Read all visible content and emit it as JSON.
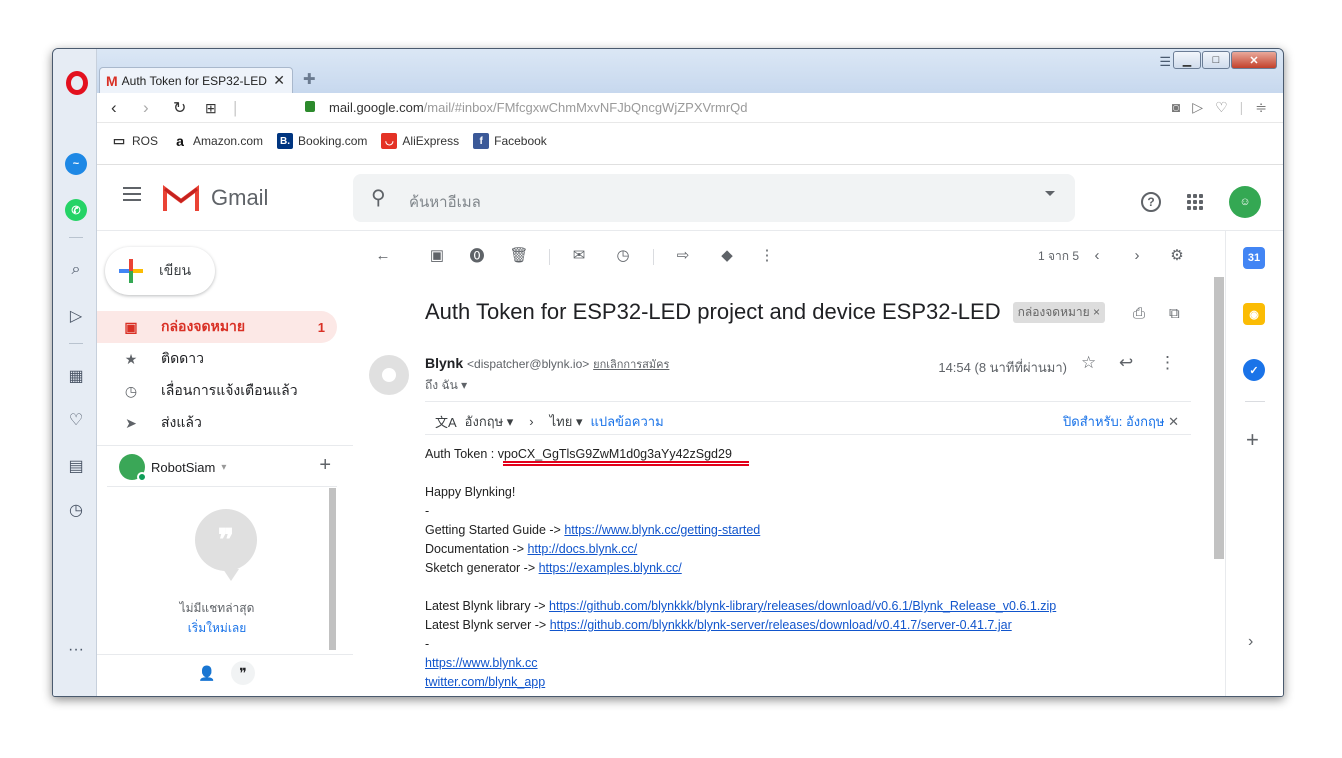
{
  "tab": {
    "title": "Auth Token for ESP32-LED",
    "favicon": "M"
  },
  "address": {
    "domain": "mail.google.com",
    "path": "/mail/#inbox/FMfcgxwChmMxvNFJbQncgWjZPXVrmrQd"
  },
  "bookmarks": [
    {
      "label": "ROS",
      "icon": "folder-icon"
    },
    {
      "label": "Amazon.com",
      "icon": "a"
    },
    {
      "label": "Booking.com",
      "icon": "B."
    },
    {
      "label": "AliExpress",
      "icon": "u"
    },
    {
      "label": "Facebook",
      "icon": "f"
    }
  ],
  "gmail": {
    "logo_text": "Gmail",
    "search_placeholder": "ค้นหาอีเมล",
    "compose_label": "เขียน",
    "nav": [
      {
        "label": "กล่องจดหมาย",
        "count": "1",
        "active": true
      },
      {
        "label": "ติดดาว",
        "count": ""
      },
      {
        "label": "เลื่อนการแจ้งเตือนแล้ว",
        "count": ""
      },
      {
        "label": "ส่งแล้ว",
        "count": ""
      }
    ],
    "hangouts": {
      "user": "RobotSiam",
      "no_chats": "ไม่มีแชทล่าสุด",
      "start_new": "เริ่มใหม่เลย"
    },
    "pagination": "1 จาก 5"
  },
  "message": {
    "subject": "Auth Token for ESP32-LED project and device ESP32-LED",
    "label": "กล่องจดหมาย ×",
    "sender_name": "Blynk",
    "sender_email": "<dispatcher@blynk.io>",
    "unsubscribe": "ยกเลิกการสมัคร",
    "to": "ถึง ฉัน",
    "time": "14:54 (8 นาทีที่ผ่านมา)",
    "translate": {
      "from": "อังกฤษ",
      "to": "ไทย",
      "action": "แปลข้อความ",
      "off": "ปิดสำหรับ: อังกฤษ"
    },
    "body": {
      "auth_prefix": "Auth Token : ",
      "auth_token": "vpoCX_GgTlsG9ZwM1d0g3aYy42zSgd29",
      "greeting": "Happy Blynking!",
      "dash": "-",
      "gs_label": "Getting Started Guide -> ",
      "gs_link": "https://www.blynk.cc/getting-started",
      "doc_label": "Documentation -> ",
      "doc_link": "http://docs.blynk.cc/",
      "sketch_label": "Sketch generator -> ",
      "sketch_link": "https://examples.blynk.cc/",
      "lib_label": "Latest Blynk library -> ",
      "lib_link": "https://github.com/blynkkk/blynk-library/releases/download/v0.6.1/Blynk_Release_v0.6.1.zip",
      "server_label": "Latest Blynk server -> ",
      "server_link": "https://github.com/blynkkk/blynk-server/releases/download/v0.41.7/server-0.41.7.jar",
      "site": "https://www.blynk.cc",
      "twitter": "twitter.com/blynk_app"
    }
  }
}
